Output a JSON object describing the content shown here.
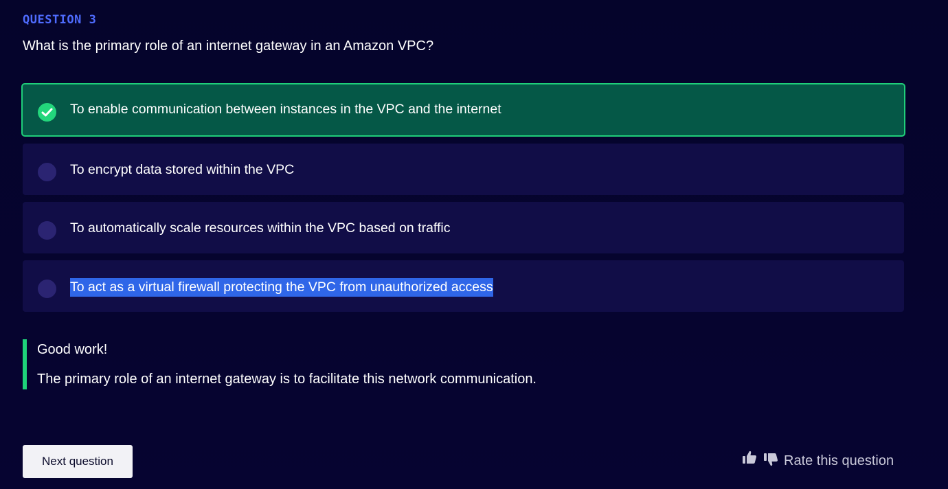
{
  "question": {
    "number_label": "QUESTION 3",
    "text": "What is the primary role of an internet gateway in an Amazon VPC?"
  },
  "options": [
    {
      "label": "To enable communication between instances in the VPC and the internet",
      "state": "correct"
    },
    {
      "label": "To encrypt data stored within the VPC",
      "state": "unselected"
    },
    {
      "label": "To automatically scale resources within the VPC based on traffic",
      "state": "unselected"
    },
    {
      "label": "To act as a virtual firewall protecting the VPC from unauthorized access",
      "state": "text-highlighted"
    }
  ],
  "feedback": {
    "title": "Good work!",
    "body": "The primary role of an internet gateway is to facilitate this network communication."
  },
  "footer": {
    "next_label": "Next question",
    "rate_label": "Rate this question",
    "thumbs_up_icon": "thumbs-up-icon",
    "thumbs_down_icon": "thumbs-down-icon"
  },
  "colors": {
    "background": "#05042b",
    "accent": "#4f6cff",
    "correct_fill": "#055847",
    "correct_border": "#1fcf7a",
    "option_fill": "#110d47",
    "selection_highlight": "#2f66e8"
  }
}
